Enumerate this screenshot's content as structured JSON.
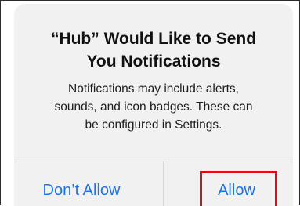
{
  "alert": {
    "title_line1": "“Hub” Would Like to Send",
    "title_line2": "You Notifications",
    "message_line1": "Notifications may include alerts,",
    "message_line2": "sounds, and icon badges. These can",
    "message_line3": "be configured in Settings.",
    "buttons": {
      "dont_allow": "Don’t Allow",
      "allow": "Allow"
    }
  },
  "colors": {
    "button_text": "#1a73e8",
    "highlight": "#d10f1e",
    "alert_background": "#f1f1f2"
  }
}
